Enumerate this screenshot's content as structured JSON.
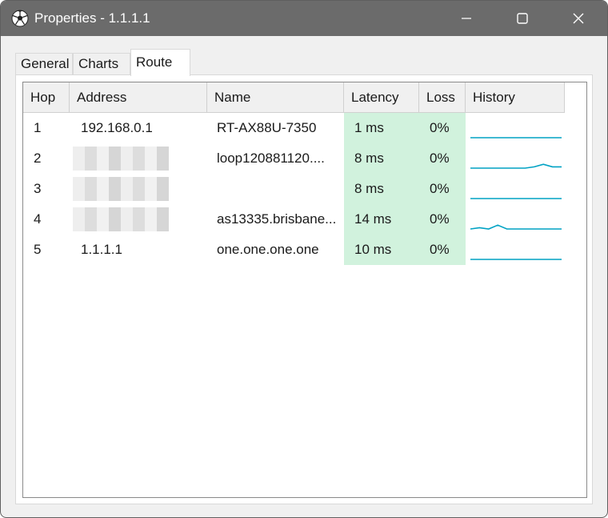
{
  "window": {
    "title": "Properties - 1.1.1.1",
    "icon": "soccer-ball-icon"
  },
  "tabs": [
    {
      "label": "General"
    },
    {
      "label": "Charts"
    },
    {
      "label": "Route",
      "selected": true
    }
  ],
  "columns": [
    "Hop",
    "Address",
    "Name",
    "Latency",
    "Loss",
    "History"
  ],
  "rows": [
    {
      "hop": "1",
      "address": "192.168.0.1",
      "address_redacted": false,
      "name": "RT-AX88U-7350",
      "latency": "1 ms",
      "loss": "0%",
      "history": [
        0,
        0,
        0,
        0,
        0,
        0,
        0,
        0,
        0,
        0
      ]
    },
    {
      "hop": "2",
      "address": "",
      "address_redacted": true,
      "name": "loop120881120....",
      "latency": "8 ms",
      "loss": "0%",
      "history": [
        0,
        0,
        0,
        0,
        0,
        0,
        0,
        1,
        3,
        1,
        1
      ]
    },
    {
      "hop": "3",
      "address": "",
      "address_redacted": true,
      "name": "",
      "latency": "8 ms",
      "loss": "0%",
      "history": [
        0,
        0,
        0,
        0,
        0,
        0,
        0,
        0,
        0,
        0
      ]
    },
    {
      "hop": "4",
      "address": "",
      "address_redacted": true,
      "name": "as13335.brisbane...",
      "latency": "14 ms",
      "loss": "0%",
      "history": [
        0,
        1,
        0,
        3,
        0,
        0,
        0,
        0,
        0,
        0,
        0
      ]
    },
    {
      "hop": "5",
      "address": "1.1.1.1",
      "address_redacted": false,
      "name": "one.one.one.one",
      "latency": "10 ms",
      "loss": "0%",
      "history": [
        0,
        0,
        0,
        0,
        0,
        0,
        0,
        0,
        0,
        0
      ]
    }
  ],
  "colors": {
    "titlebar": "#6b6b6b",
    "good_cell": "#d1f2dd",
    "history_line": "#00a2c4"
  }
}
